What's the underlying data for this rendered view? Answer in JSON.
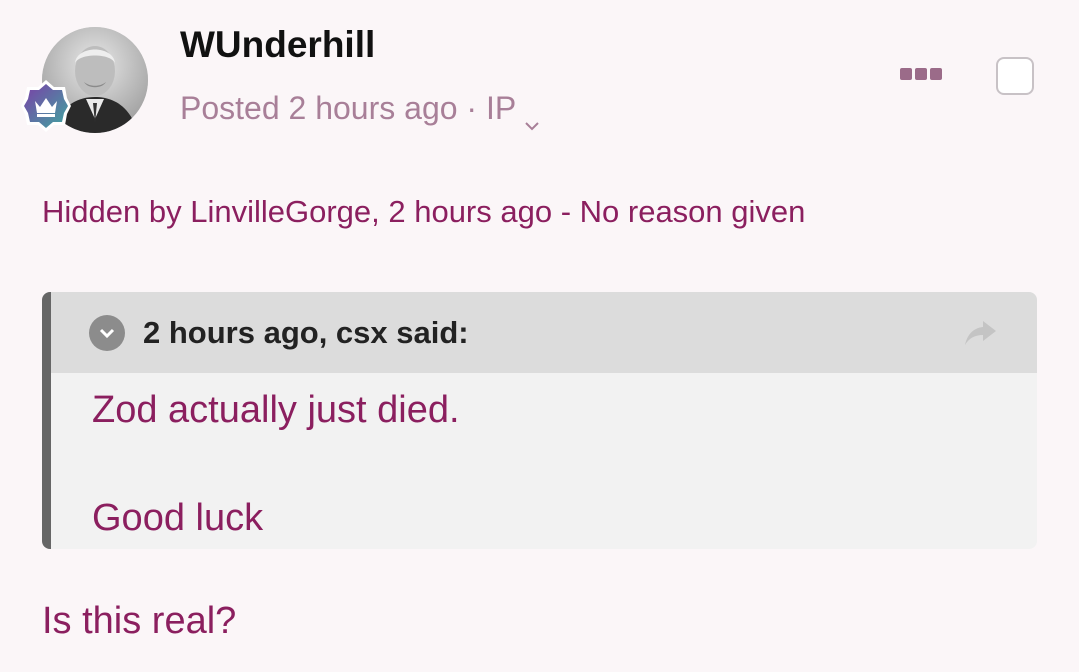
{
  "post": {
    "author": "WUnderhill",
    "meta_prefix": "Posted",
    "time": "2 hours ago",
    "separator": "·",
    "ip_label": "IP",
    "hidden_note": "Hidden by LinvilleGorge, 2 hours ago - No reason given",
    "quote": {
      "citation": "2 hours ago, csx said:",
      "line1": "Zod actually just died.",
      "line2": "Good luck"
    },
    "body": "Is this real?"
  },
  "icons": {
    "avatar": "avatar-photo",
    "badge": "crown-badge-icon",
    "more": "more-options-icon",
    "chevron": "chevron-down-icon",
    "expand": "chevron-down-icon",
    "share": "share-arrow-icon"
  },
  "colors": {
    "accent": "#8b1f5f",
    "meta": "#a87f98",
    "background": "#fbf6f8",
    "quote_bg": "#f2f2f2",
    "quote_header_bg": "#dcdcdc"
  }
}
